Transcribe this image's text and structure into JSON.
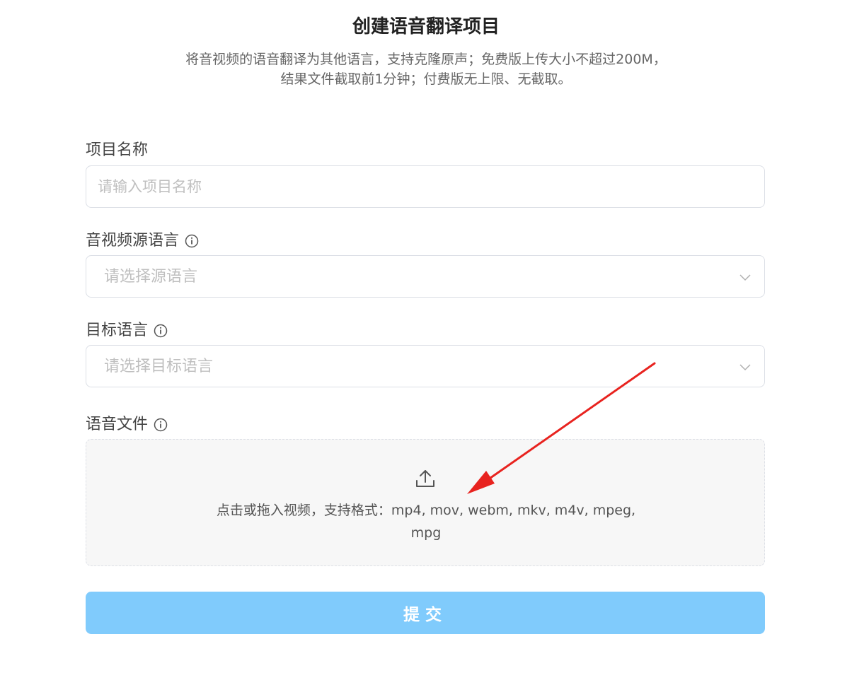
{
  "header": {
    "title": "创建语音翻译项目",
    "subtitle": "将音视频的语音翻译为其他语言，支持克隆原声；免费版上传大小不超过200M，结果文件截取前1分钟；付费版无上限、无截取。"
  },
  "form": {
    "project_name": {
      "label": "项目名称",
      "placeholder": "请输入项目名称",
      "value": ""
    },
    "source_language": {
      "label": "音视频源语言",
      "placeholder": "请选择源语言",
      "icon": "info-icon"
    },
    "target_language": {
      "label": "目标语言",
      "placeholder": "请选择目标语言",
      "icon": "info-icon"
    },
    "audio_file": {
      "label": "语音文件",
      "icon": "info-icon",
      "upload_hint": "点击或拖入视频，支持格式：mp4, mov, webm, mkv, m4v, mpeg, mpg",
      "upload_icon": "upload-icon"
    },
    "submit_label": "提交"
  },
  "colors": {
    "submit_button": "#80cbfc",
    "annotation_arrow": "#e8231f",
    "border": "#dcdfe6",
    "placeholder": "#bfbfbf"
  }
}
